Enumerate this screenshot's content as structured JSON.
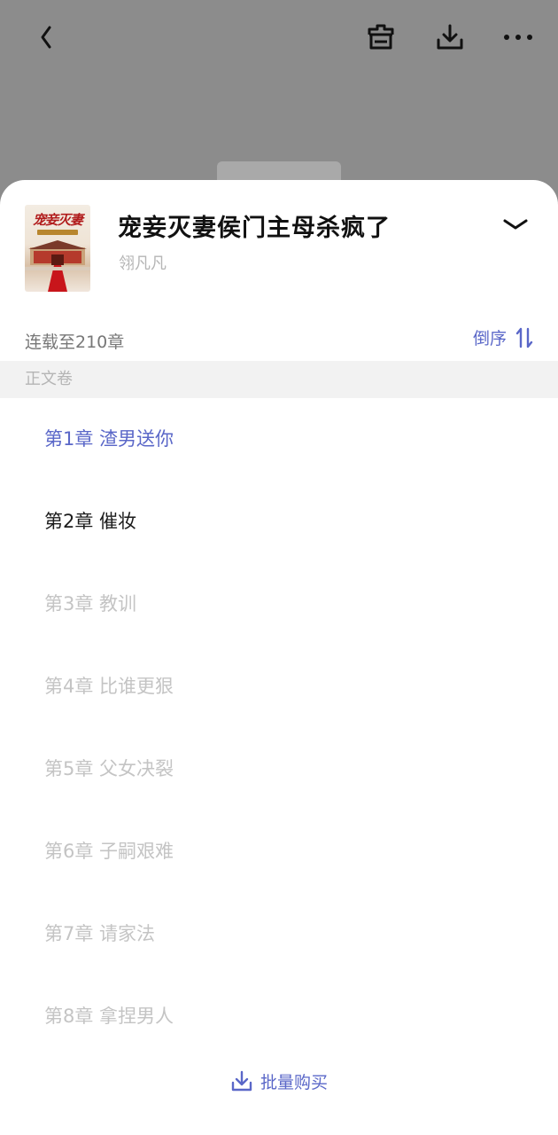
{
  "topbar": {
    "icons": [
      "back-icon",
      "bookshelf-add-icon",
      "download-icon",
      "more-icon"
    ]
  },
  "book": {
    "title": "宠妾灭妻侯门主母杀疯了",
    "author": "翎凡凡",
    "cover_title": "宠妾灭妻"
  },
  "catalog": {
    "status": "连载至210章",
    "sort_label": "倒序",
    "volume": "正文卷",
    "chapters": [
      {
        "label": "第1章 渣男送你",
        "state": "current"
      },
      {
        "label": "第2章 催妆",
        "state": "read"
      },
      {
        "label": "第3章 教训",
        "state": "locked"
      },
      {
        "label": "第4章 比谁更狠",
        "state": "locked"
      },
      {
        "label": "第5章 父女决裂",
        "state": "locked"
      },
      {
        "label": "第6章 子嗣艰难",
        "state": "locked"
      },
      {
        "label": "第7章 请家法",
        "state": "locked"
      },
      {
        "label": "第8章 拿捏男人",
        "state": "locked"
      }
    ],
    "batch_label": "批量购买"
  },
  "colors": {
    "accent": "#5a67c8",
    "overlay": "#8c8c8c",
    "muted_text": "#c4c4c4"
  }
}
